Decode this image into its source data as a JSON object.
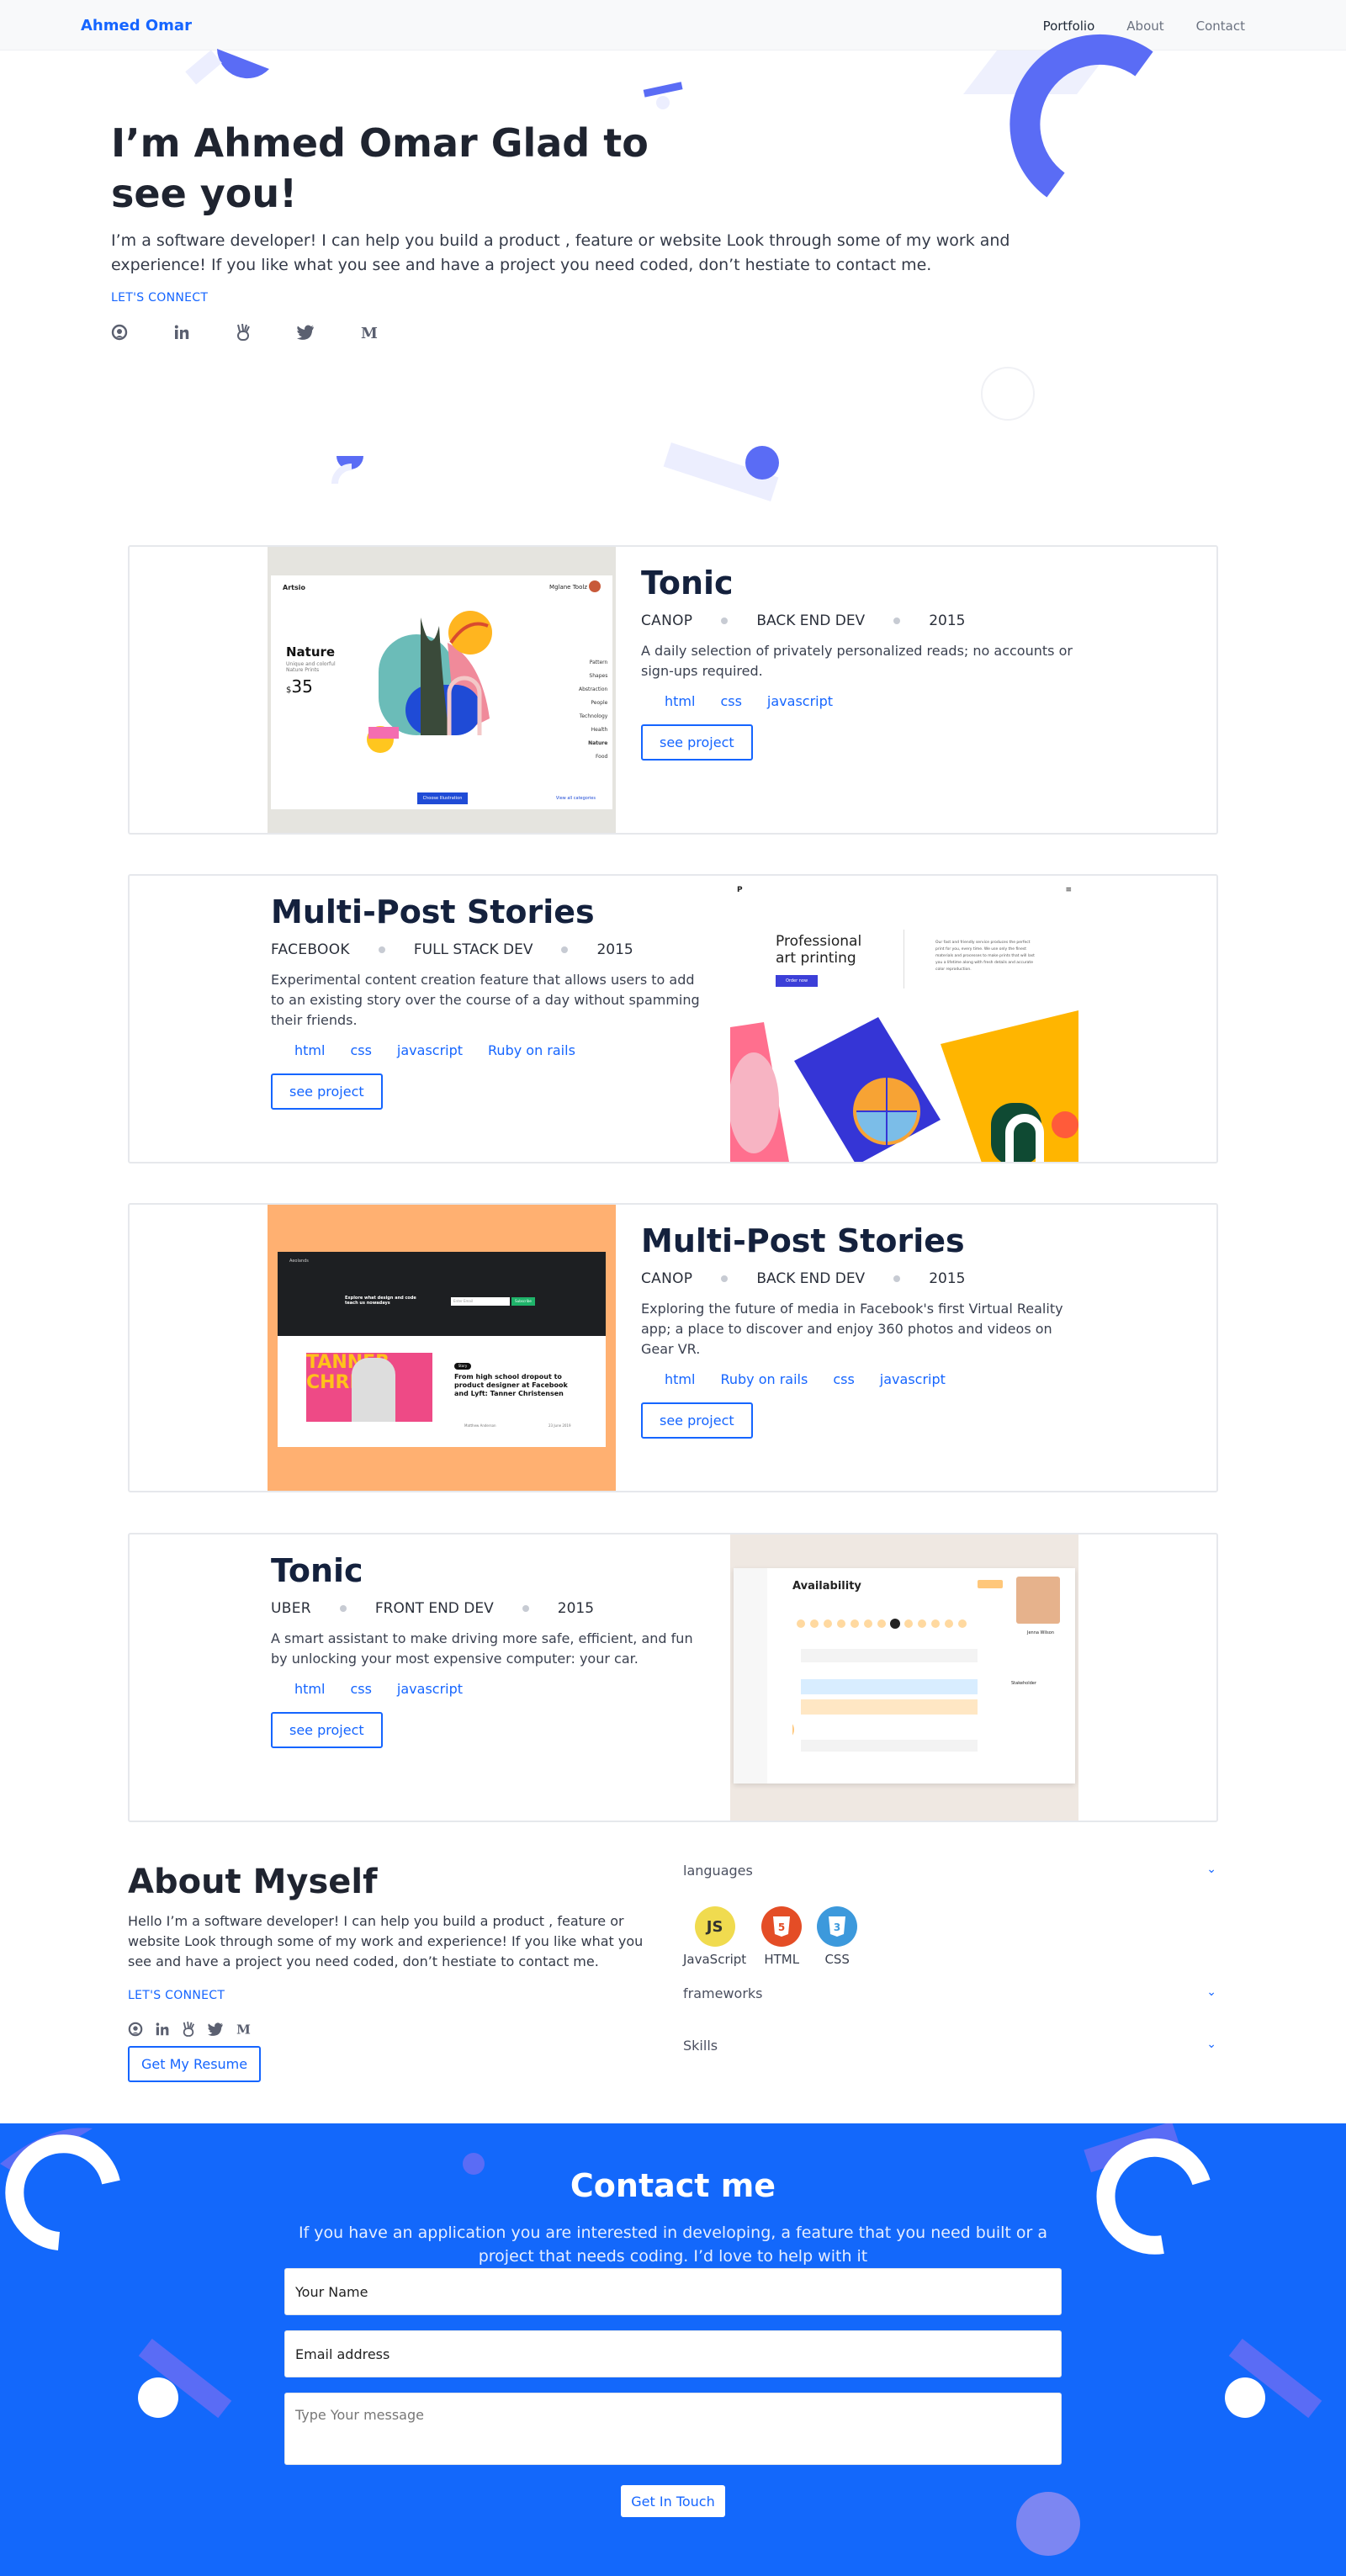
{
  "nav": {
    "brand": "Ahmed Omar",
    "links": [
      "Portfolio",
      "About",
      "Contact"
    ]
  },
  "hero": {
    "title": "I’m Ahmed Omar Glad to see you!",
    "text": "I’m a software developer! I can help you build a product , feature or website Look through some of my work and experience! If you like what you see and have a project you need coded, don’t hestiate to contact me.",
    "connect": "LET'S CONNECT",
    "socials": [
      "github-icon",
      "linkedin-icon",
      "angellist-icon",
      "twitter-icon",
      "medium-icon"
    ]
  },
  "projects": [
    {
      "title": "Tonic",
      "client": "CANOP",
      "role": "BACK END DEV",
      "year": "2015",
      "desc": "A daily selection of privately personalized reads; no accounts or sign-ups required.",
      "tags": [
        "html",
        "css",
        "javascript"
      ],
      "button": "see project",
      "shot": {
        "brand": "Artsio",
        "user": "Mglane Toolz",
        "heading": "Nature",
        "caption": "Unique and colorful Nature Prints",
        "price": "35",
        "currency": "$",
        "menu": [
          "Pattern",
          "Shapes",
          "Abstraction",
          "People",
          "Technology",
          "Health",
          "Nature",
          "Food"
        ],
        "cta": "Choose Illustration",
        "link": "View all categories"
      }
    },
    {
      "title": "Multi-Post Stories",
      "client": "FACEBOOK",
      "role": "FULL STACK DEV",
      "year": "2015",
      "desc": "Experimental content creation feature that allows users to add to an existing story over the course of a day without spamming their friends.",
      "tags": [
        "html",
        "css",
        "javascript",
        "Ruby on rails"
      ],
      "button": "see project",
      "shot": {
        "logo": "P",
        "heading": "Professional art printing",
        "body": "Our fast and friendly service produces the perfect print for you, every time. We use only the finest materials and processes to make prints that will last you a lifetime along with fresh details and accurate color reproduction.",
        "cta": "Order now"
      }
    },
    {
      "title": "Multi-Post Stories",
      "client": "CANOP",
      "role": "BACK END DEV",
      "year": "2015",
      "desc": "Exploring the future of media in Facebook's first Virtual Reality app; a place to discover and enjoy 360 photos and videos on Gear VR.",
      "tags": [
        "html",
        "Ruby on rails",
        "css",
        "javascript"
      ],
      "button": "see project",
      "shot": {
        "brand": "Aeolands",
        "hero_text": "Explore what design and code teach us nowadays",
        "input": "Enter Email",
        "cta": "Subscribe",
        "banner": "TANNER CHRIS",
        "badge": "Story",
        "headline": "From high school dropout to product designer at Facebook and Lyft: Tanner Christensen",
        "author": "Matthew Anderson",
        "date": "23 June 2019"
      }
    },
    {
      "title": "Tonic",
      "client": "UBER",
      "role": "FRONT END DEV",
      "year": "2015",
      "desc": "A smart assistant to make driving more safe, efficient, and fun by unlocking your most expensive computer: your car.",
      "tags": [
        "html",
        "css",
        "javascript"
      ],
      "button": "see project",
      "shot": {
        "heading": "Availability",
        "person": "Jenna Wilson",
        "section": "Stakeholder"
      }
    }
  ],
  "about": {
    "title": "About Myself",
    "text": "Hello I’m a software developer! I can help you build a product , feature or website Look through some of my work and experience! If you like what you see and have a project you need coded, don’t hestiate to contact me.",
    "connect": "LET'S CONNECT",
    "resume": "Get My Resume",
    "sections": [
      "languages",
      "frameworks",
      "Skills"
    ],
    "languages": [
      {
        "name": "JavaScript",
        "icon": "javascript-icon",
        "color": "#f0db4f",
        "glyph": "JS"
      },
      {
        "name": "HTML",
        "icon": "html5-icon",
        "color": "#e44d26",
        "glyph": "5"
      },
      {
        "name": "CSS",
        "icon": "css3-icon",
        "color": "#3c99dc",
        "glyph": "3"
      }
    ]
  },
  "contact": {
    "title": "Contact me",
    "subtitle": "If you have an application you are interested in developing, a feature that you need built or a project that needs coding. I’d love to help with it",
    "name_placeholder": "Your Name",
    "email_placeholder": "Email address",
    "message_placeholder": "Type Your message",
    "button": "Get In Touch"
  },
  "colors": {
    "accent": "#1565ff",
    "contact_bg": "#1368fb",
    "decor": "#5a6cf5",
    "heading": "#14213d"
  }
}
